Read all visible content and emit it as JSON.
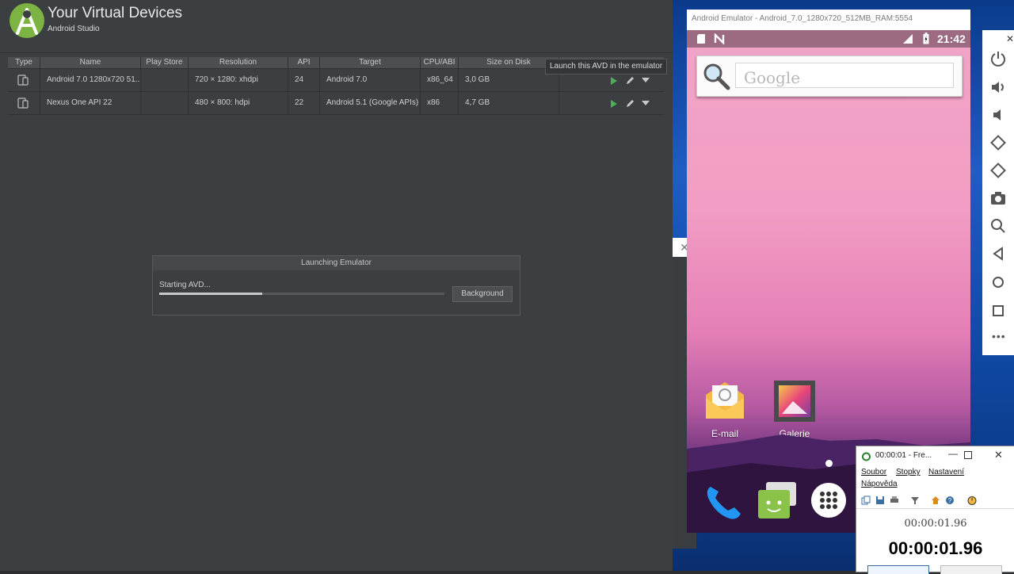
{
  "avd_manager": {
    "title": "Your Virtual Devices",
    "subtitle": "Android Studio",
    "columns": [
      "Type",
      "Name",
      "Play Store",
      "Resolution",
      "API",
      "Target",
      "CPU/ABI",
      "Size on Disk"
    ],
    "rows": [
      {
        "name": "Android 7.0 1280x720 51...",
        "play_store": "",
        "resolution": "720 × 1280: xhdpi",
        "api": "24",
        "target": "Android 7.0",
        "cpu": "x86_64",
        "size": "3,0 GB"
      },
      {
        "name": "Nexus One API 22",
        "play_store": "",
        "resolution": "480 × 800: hdpi",
        "api": "22",
        "target": "Android 5.1 (Google APIs)",
        "cpu": "x86",
        "size": "4,7 GB"
      }
    ],
    "tooltip": "Launch this AVD in the emulator",
    "launch_dialog": {
      "title": "Launching Emulator",
      "status": "Starting AVD...",
      "progress": 0.36,
      "button": "Background"
    }
  },
  "emulator": {
    "window_title": "Android Emulator - Android_7.0_1280x720_512MB_RAM:5554",
    "clock": "21:42",
    "search_placeholder": "Google",
    "apps": [
      "E-mail",
      "Galerie"
    ],
    "toolbar_icons": [
      "power-icon",
      "volume-up-icon",
      "volume-down-icon",
      "rotate-left-icon",
      "rotate-right-icon",
      "camera-icon",
      "zoom-icon",
      "back-icon",
      "home-icon",
      "overview-icon",
      "more-icon"
    ]
  },
  "stopwatch": {
    "window_title": "00:00:01 - Fre...",
    "menu": [
      "Soubor",
      "Stopky",
      "Nastavení",
      "Nápověda"
    ],
    "time_small": "00:00:01.96",
    "time_big": "00:00:01.96"
  },
  "colors": {
    "android_green": "#7cb342",
    "play_green": "#4caf50",
    "dark_bg": "#3c3f41"
  }
}
